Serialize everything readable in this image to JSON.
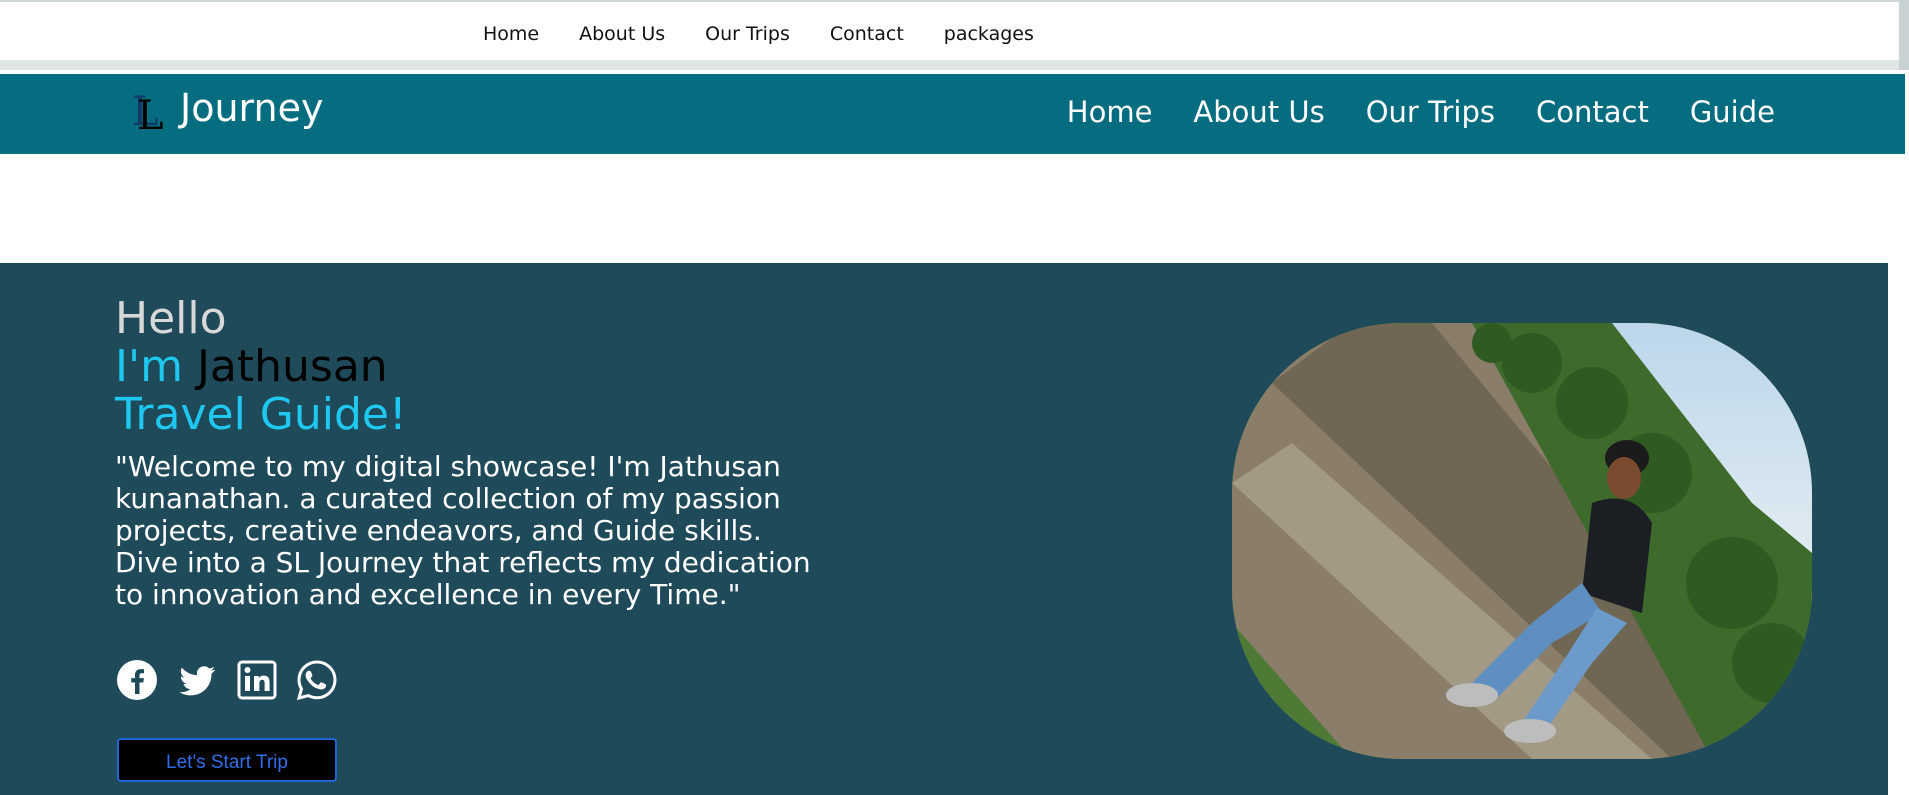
{
  "topnav": {
    "items": [
      "Home",
      "About Us",
      "Our Trips",
      "Contact",
      "packages"
    ]
  },
  "header": {
    "logo_letters": [
      "L",
      "L"
    ],
    "brand": "Journey",
    "nav": [
      "Home",
      "About Us",
      "Our Trips",
      "Contact",
      "Guide"
    ],
    "bg_color": "#066c80"
  },
  "hero": {
    "greeting": "Hello",
    "im_prefix": "I'm",
    "name": "Jathusan",
    "role": "Travel Guide!",
    "bio": "\"Welcome to my digital showcase! I'm Jathusan kunanathan. a curated collection of my passion projects, creative endeavors, and Guide skills. Dive into a SL Journey that reflects my dedication to innovation and excellence in every Time.\"",
    "socials": [
      "facebook-icon",
      "twitter-icon",
      "linkedin-icon",
      "whatsapp-icon"
    ],
    "cta_label": "Let's Start Trip",
    "bg_color": "#1e4a5a",
    "accent_color": "#1ec8f0"
  }
}
